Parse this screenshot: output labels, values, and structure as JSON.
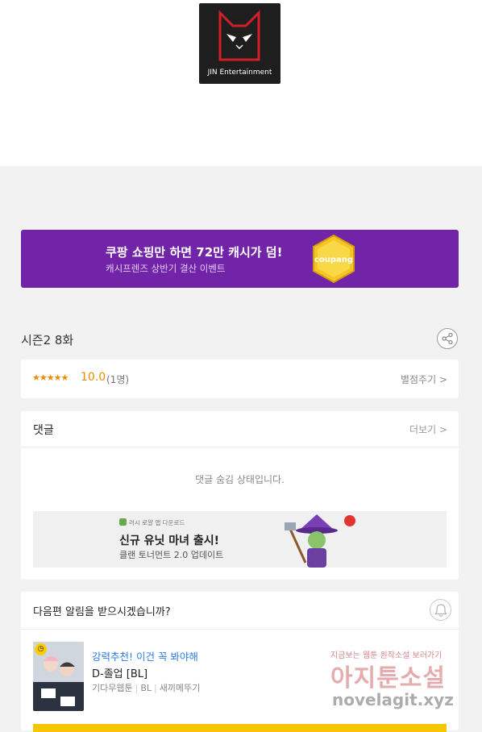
{
  "publisher": {
    "logo_text": "JIN Entertainment",
    "background": "#1e1e1e",
    "accent": "#d11f28"
  },
  "banner": {
    "title": "쿠팡 쇼핑만 하면 72만 캐시가 덤!",
    "subtitle": "캐시프렌즈 상반기 결산 이벤트",
    "badge_text": "coupang",
    "background": "#7124a8"
  },
  "episode": {
    "title": "시즌2 8화",
    "share_icon": "share-icon"
  },
  "rating": {
    "stars": "★★★★★",
    "score": "10.0",
    "count": "(1명)",
    "rate_link": "별점주기 >"
  },
  "comments": {
    "title": "댓글",
    "more_link": "더보기 >",
    "hidden_message": "댓글 숨김 상태입니다."
  },
  "ad": {
    "tag": "러시 로얄 앱 다운로드",
    "title": "신규 유닛 마녀 출시!",
    "subtitle": "클랜 토너먼트 2.0 업데이트"
  },
  "notify": {
    "question": "다음편 알림을 받으시겠습니까?",
    "bell_icon": "bell-icon"
  },
  "recommendation": {
    "label": "강력추천! 이건 꼭 봐야해",
    "title": "D-졸업 [BL]",
    "meta": [
      "기다무웹툰",
      "BL",
      "새끼메뚜기"
    ]
  },
  "watermark": {
    "top": "지금보는 웹툰 원작소설 보러가기",
    "big": "아지툰소설",
    "url": "novelagit.xyz"
  }
}
